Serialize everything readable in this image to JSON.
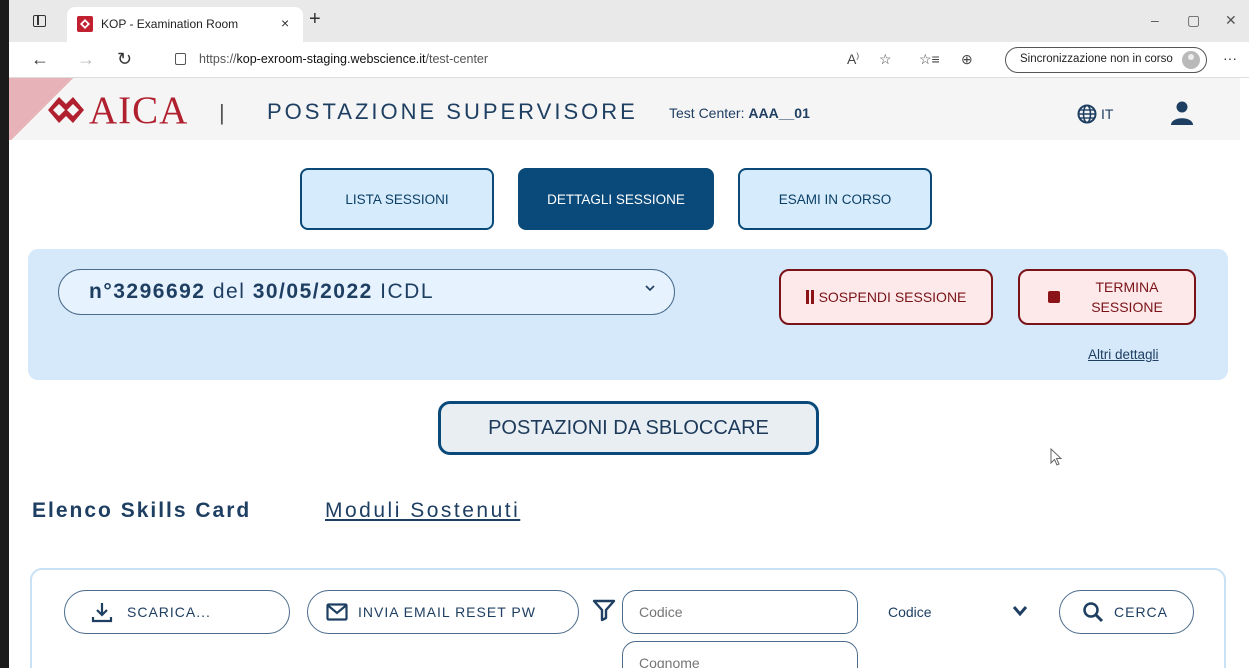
{
  "browser": {
    "tab_title": "KOP - Examination Room",
    "tab_close": "×",
    "new_tab": "+",
    "minimize": "–",
    "restore": "▢",
    "close": "✕",
    "url_prefix": "https://",
    "url_host": "kop-exroom-staging.webscience.it",
    "url_path": "/test-center",
    "sync_label": "Sincronizzazione non in corso",
    "more": "···"
  },
  "header": {
    "brand": "AICA",
    "separator": "|",
    "title": "POSTAZIONE SUPERVISORE",
    "test_center_label": "Test Center: ",
    "test_center_value": "AAA__01",
    "language": "IT"
  },
  "nav": {
    "tabs": [
      {
        "label": "LISTA SESSIONI",
        "active": false
      },
      {
        "label": "DETTAGLI SESSIONE",
        "active": true
      },
      {
        "label": "ESAMI IN CORSO",
        "active": false
      }
    ]
  },
  "session": {
    "prefix": "n°",
    "number": "3296692",
    "del": " del ",
    "date": "30/05/2022",
    "type": " ICDL",
    "suspend_label": "SOSPENDI SESSIONE",
    "terminate_label": "TERMINA SESSIONE",
    "more_details": "Altri dettagli"
  },
  "postazioni_button": "POSTAZIONI DA SBLOCCARE",
  "sections": {
    "active": "Elenco Skills Card",
    "other": "Moduli Sostenuti"
  },
  "filters": {
    "download_label": "SCARICA...",
    "email_reset_label": "INVIA EMAIL RESET PW",
    "codice_placeholder": "Codice",
    "cognome_placeholder": "Cognome",
    "search_by": "Codice",
    "search_label": "CERCA"
  },
  "colors": {
    "primary": "#0a4a7a",
    "light_primary": "#d6ebfb",
    "danger": "#7a1318",
    "brand_red": "#b0202e"
  }
}
